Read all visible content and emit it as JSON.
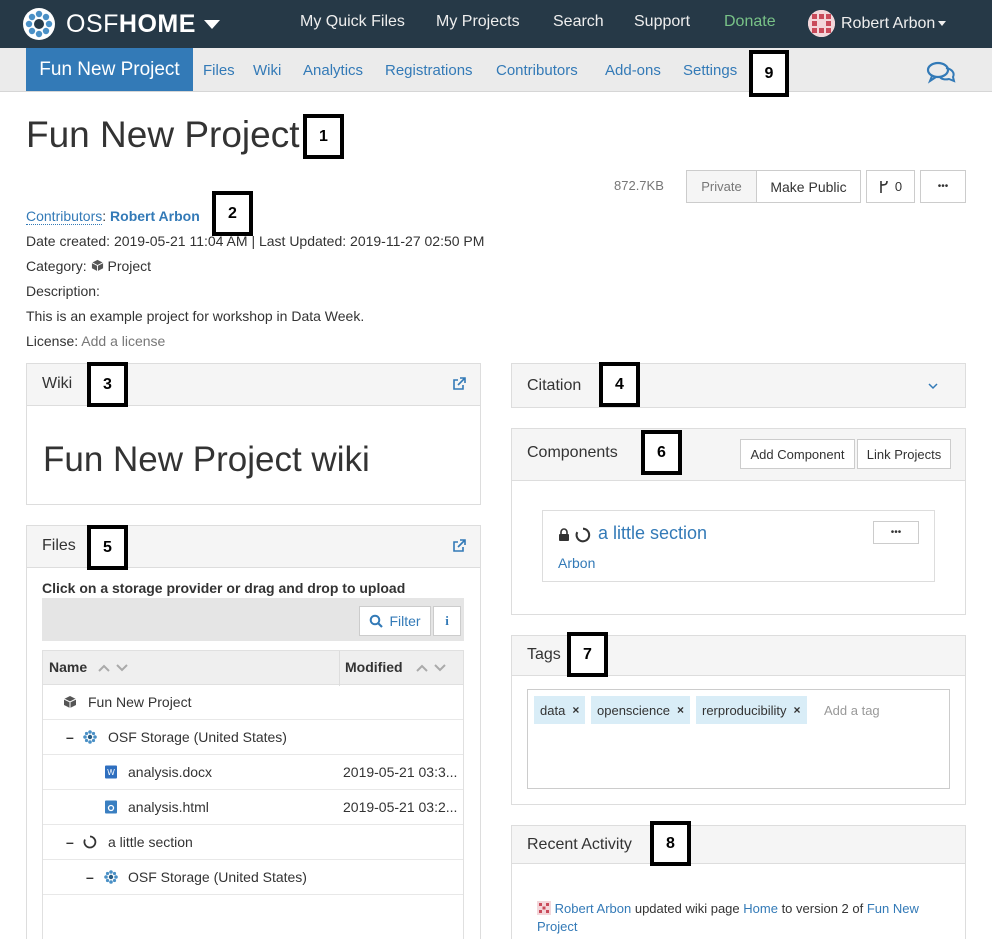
{
  "topbar": {
    "brand_osf": "OSF",
    "brand_home": "HOME",
    "links": {
      "quick_files": "My Quick Files",
      "projects": "My Projects",
      "search": "Search",
      "support": "Support",
      "donate": "Donate"
    },
    "user_name": "Robert Arbon"
  },
  "subnav": {
    "project": "Fun New Project",
    "files": "Files",
    "wiki": "Wiki",
    "analytics": "Analytics",
    "registrations": "Registrations",
    "contributors": "Contributors",
    "addons": "Add-ons",
    "settings": "Settings"
  },
  "markers": [
    "1",
    "2",
    "3",
    "4",
    "5",
    "6",
    "7",
    "8",
    "9"
  ],
  "project": {
    "title": "Fun New Project",
    "size": "872.7KB",
    "private_label": "Private",
    "make_public_label": "Make Public",
    "fork_count": "0",
    "more_label": "•••",
    "contributors_label": "Contributors",
    "contributors_sep": ":",
    "contributor": "Robert Arbon",
    "dates": "Date created: 2019-05-21 11:04 AM | Last Updated: 2019-11-27 02:50 PM",
    "category_label": "Category:",
    "category": "Project",
    "description_label": "Description:",
    "description": "This is an example project for workshop in Data Week.",
    "license_label": "License:",
    "license_link": "Add a license"
  },
  "wiki": {
    "title": "Wiki",
    "heading": "Fun New Project wiki"
  },
  "citation": {
    "title": "Citation"
  },
  "files": {
    "title": "Files",
    "hint": "Click on a storage provider or drag and drop to upload",
    "filter_label": "Filter",
    "info_label": "i",
    "col_name": "Name",
    "col_modified": "Modified",
    "rows": [
      {
        "toggle": "",
        "name": "Fun New Project",
        "modified": ""
      },
      {
        "toggle": "–",
        "name": "OSF Storage (United States)",
        "modified": ""
      },
      {
        "toggle": "",
        "name": "analysis.docx",
        "modified": "2019-05-21 03:3..."
      },
      {
        "toggle": "",
        "name": "analysis.html",
        "modified": "2019-05-21 03:2..."
      },
      {
        "toggle": "–",
        "name": "a little section",
        "modified": ""
      },
      {
        "toggle": "–",
        "name": "OSF Storage (United States)",
        "modified": ""
      }
    ]
  },
  "components": {
    "title": "Components",
    "add_label": "Add Component",
    "link_label": "Link Projects",
    "item_title": "a little section",
    "item_author": "Arbon",
    "item_more": "•••"
  },
  "tags": {
    "title": "Tags",
    "items": [
      {
        "label": "data",
        "remove": "×"
      },
      {
        "label": "openscience",
        "remove": "×"
      },
      {
        "label": "rerproducibility",
        "remove": "×"
      }
    ],
    "placeholder": "Add a tag"
  },
  "activity": {
    "title": "Recent Activity",
    "user": "Robert Arbon",
    "text1": " updated wiki page ",
    "page": "Home",
    "text2": " to version 2 of ",
    "project": "Fun New Project"
  }
}
